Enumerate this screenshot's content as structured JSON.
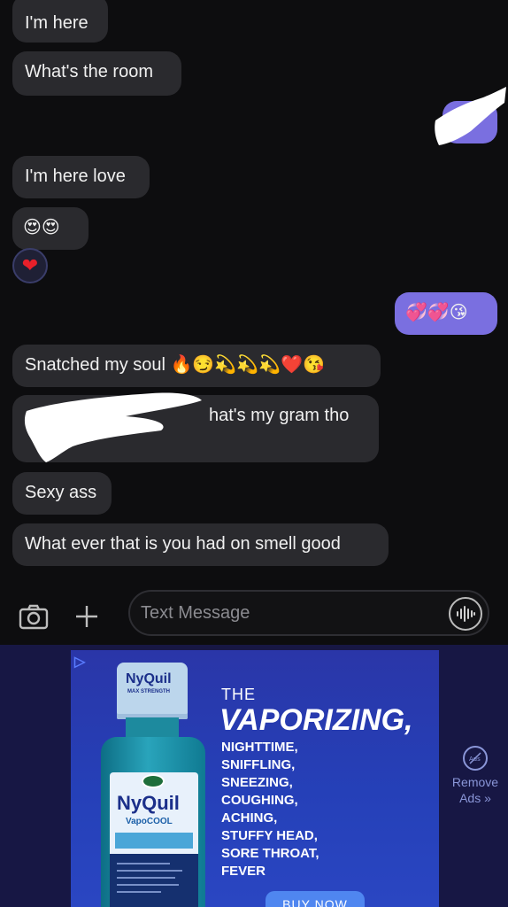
{
  "messages": [
    {
      "text": "I'm here",
      "direction": "incoming"
    },
    {
      "text": "What's the room",
      "direction": "incoming"
    },
    {
      "text": "I'm here love",
      "direction": "incoming"
    },
    {
      "text": "😍😍",
      "direction": "incoming"
    },
    {
      "text": "💞💞😘",
      "direction": "outgoing"
    },
    {
      "text": "Snatched my soul 🔥😏💫💫💫❤️😘",
      "direction": "incoming"
    },
    {
      "text": "hat's my gram tho",
      "direction": "incoming"
    },
    {
      "text": "Sexy ass",
      "direction": "incoming"
    },
    {
      "text": "What ever that is you had on smell good",
      "direction": "incoming"
    }
  ],
  "tapback": {
    "emoji": "❤"
  },
  "composer": {
    "placeholder": "Text Message",
    "camera_icon": "camera-icon",
    "plus_icon": "plus-icon",
    "voice_icon": "voice-waveform-icon"
  },
  "ad": {
    "bottle_brand": "NyQuil",
    "bottle_sub": "MAX STRENGTH",
    "bottle_label_brand": "NyQuil",
    "bottle_label_variant": "VapoCOOL",
    "the": "THE",
    "headline": "VAPORIZING,",
    "symptoms": [
      "NIGHTTIME,",
      "SNIFFLING,",
      "SNEEZING,",
      "COUGHING,",
      "ACHING,",
      "STUFFY HEAD,",
      "SORE THROAT,",
      "FEVER"
    ],
    "cta": "BUY NOW",
    "remove_ads_line1": "Remove",
    "remove_ads_line2": "Ads »"
  },
  "colors": {
    "background": "#0d0d0f",
    "incoming_bubble": "#2a2a2e",
    "outgoing_bubble": "#7a6fe0",
    "ad_background": "#171744",
    "ad_card": "#2540b8"
  }
}
